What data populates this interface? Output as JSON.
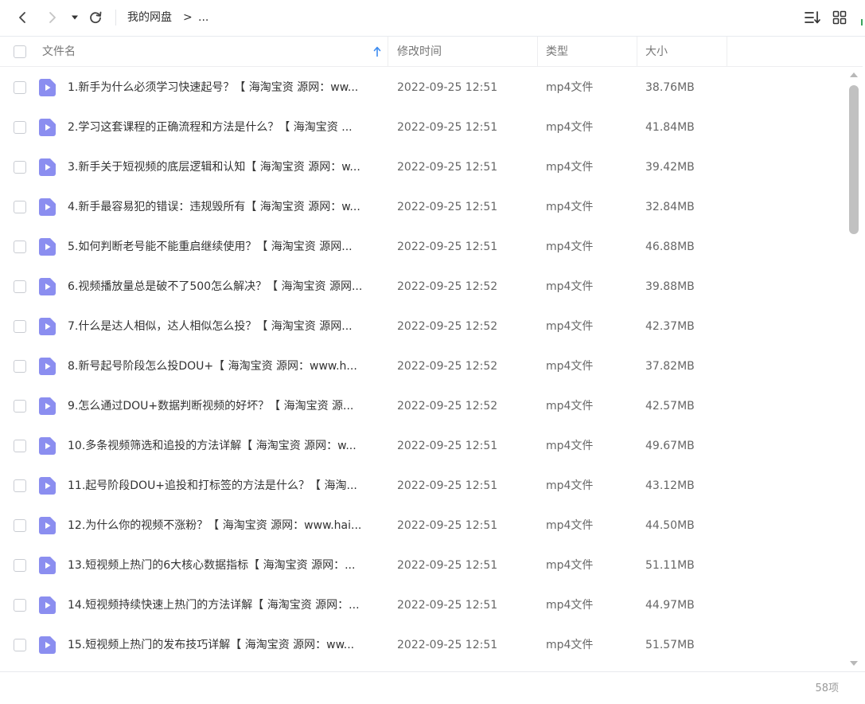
{
  "toolbar": {
    "breadcrumb_root": "我的网盘",
    "breadcrumb_separator": ">",
    "breadcrumb_more": "..."
  },
  "columns": {
    "name": "文件名",
    "modified": "修改时间",
    "type": "类型",
    "size": "大小"
  },
  "colors": {
    "file_icon": "#8b8ef0",
    "sort_arrow": "#3d8cf0",
    "accent_green": "#3aa55c"
  },
  "files": [
    {
      "name": "1.新手为什么必须学习快速起号？【 海淘宝资 源网：ww...",
      "modified": "2022-09-25 12:51",
      "type": "mp4文件",
      "size": "38.76MB"
    },
    {
      "name": "2.学习这套课程的正确流程和方法是什么？【 海淘宝资 ...",
      "modified": "2022-09-25 12:51",
      "type": "mp4文件",
      "size": "41.84MB"
    },
    {
      "name": "3.新手关于短视频的底层逻辑和认知【 海淘宝资 源网：w...",
      "modified": "2022-09-25 12:51",
      "type": "mp4文件",
      "size": "39.42MB"
    },
    {
      "name": "4.新手最容易犯的错误：违规毁所有【 海淘宝资 源网：w...",
      "modified": "2022-09-25 12:51",
      "type": "mp4文件",
      "size": "32.84MB"
    },
    {
      "name": "5.如何判断老号能不能重启继续使用？【 海淘宝资 源网...",
      "modified": "2022-09-25 12:51",
      "type": "mp4文件",
      "size": "46.88MB"
    },
    {
      "name": "6.视频播放量总是破不了500怎么解决？【 海淘宝资 源网...",
      "modified": "2022-09-25 12:52",
      "type": "mp4文件",
      "size": "39.88MB"
    },
    {
      "name": "7.什么是达人相似，达人相似怎么投？【 海淘宝资 源网...",
      "modified": "2022-09-25 12:52",
      "type": "mp4文件",
      "size": "42.37MB"
    },
    {
      "name": "8.新号起号阶段怎么投DOU+【 海淘宝资 源网：www.h...",
      "modified": "2022-09-25 12:52",
      "type": "mp4文件",
      "size": "37.82MB"
    },
    {
      "name": "9.怎么通过DOU+数据判断视频的好坏？【 海淘宝资 源...",
      "modified": "2022-09-25 12:52",
      "type": "mp4文件",
      "size": "42.57MB"
    },
    {
      "name": "10.多条视频筛选和追投的方法详解【 海淘宝资 源网：w...",
      "modified": "2022-09-25 12:51",
      "type": "mp4文件",
      "size": "49.67MB"
    },
    {
      "name": "11.起号阶段DOU+追投和打标签的方法是什么？【 海淘...",
      "modified": "2022-09-25 12:51",
      "type": "mp4文件",
      "size": "43.12MB"
    },
    {
      "name": "12.为什么你的视频不涨粉？【 海淘宝资 源网：www.hai...",
      "modified": "2022-09-25 12:51",
      "type": "mp4文件",
      "size": "44.50MB"
    },
    {
      "name": "13.短视频上热门的6大核心数据指标【 海淘宝资 源网：...",
      "modified": "2022-09-25 12:51",
      "type": "mp4文件",
      "size": "51.11MB"
    },
    {
      "name": "14.短视频持续快速上热门的方法详解【 海淘宝资 源网：...",
      "modified": "2022-09-25 12:51",
      "type": "mp4文件",
      "size": "44.97MB"
    },
    {
      "name": "15.短视频上热门的发布技巧详解【 海淘宝资 源网：ww...",
      "modified": "2022-09-25 12:51",
      "type": "mp4文件",
      "size": "51.57MB"
    }
  ],
  "footer": {
    "item_count": "58项"
  }
}
